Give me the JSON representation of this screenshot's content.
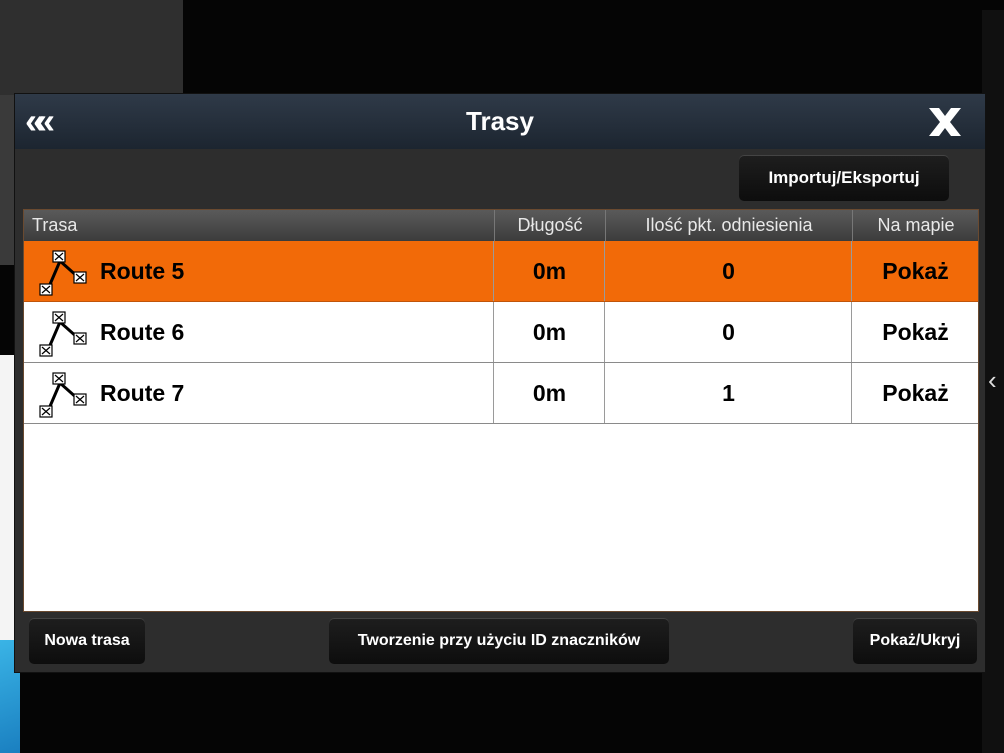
{
  "dialog": {
    "title": "Trasy",
    "back_icon": "double-chevron-left-icon",
    "close_icon": "close-x-icon",
    "export_button": "Importuj/Eksportuj"
  },
  "table": {
    "columns": [
      "Trasa",
      "Długość",
      "Ilość pkt. odniesienia",
      "Na mapie"
    ],
    "rows": [
      {
        "name": "Route 5",
        "length": "0m",
        "waypoints": "0",
        "map_action": "Pokaż",
        "selected": true
      },
      {
        "name": "Route 6",
        "length": "0m",
        "waypoints": "0",
        "map_action": "Pokaż",
        "selected": false
      },
      {
        "name": "Route 7",
        "length": "0m",
        "waypoints": "1",
        "map_action": "Pokaż",
        "selected": false
      }
    ]
  },
  "footer": {
    "new_route": "Nowa trasa",
    "create_by_id": "Tworzenie przy użyciu ID znaczników",
    "show_hide": "Pokaż/Ukryj"
  },
  "colors": {
    "selected_row": "#f26a08",
    "title_bar": "#1c2530"
  }
}
